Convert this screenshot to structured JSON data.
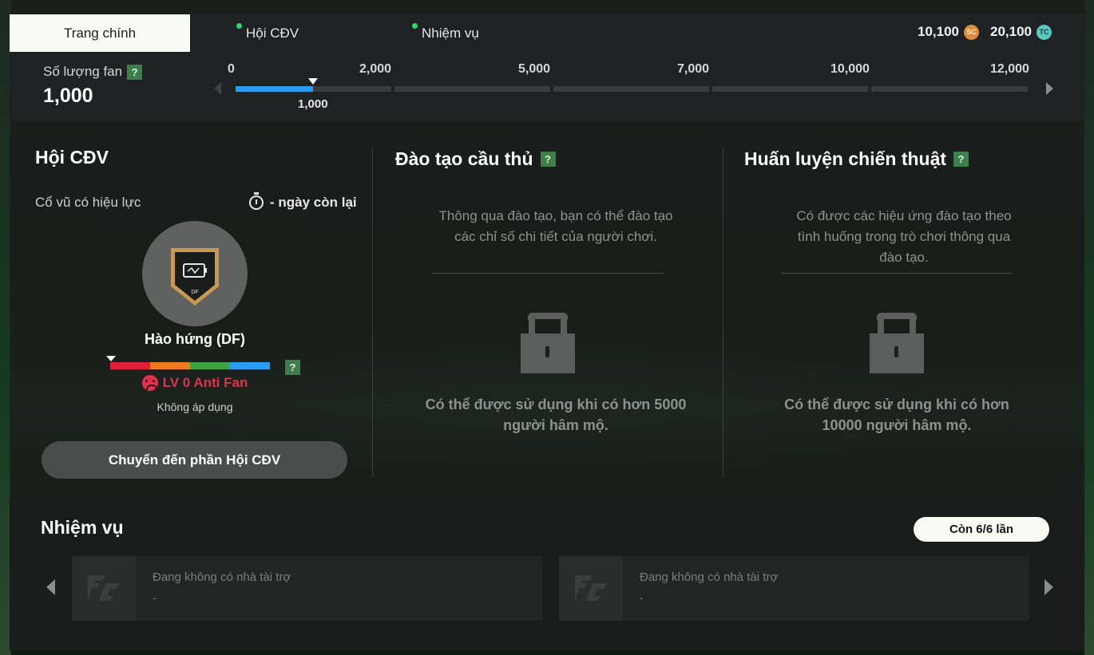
{
  "tabs": {
    "home": "Trang chính",
    "fans": "Hội CĐV",
    "missions": "Nhiệm vụ"
  },
  "currency": {
    "sc_value": "10,100",
    "sc_icon": "SC",
    "tc_value": "20,100",
    "tc_icon": "TC"
  },
  "fan_count": {
    "label": "Số lượng fan",
    "help": "?",
    "value": "1,000",
    "ticks": [
      "0",
      "2,000",
      "5,000",
      "7,000",
      "10,000",
      "12,000"
    ],
    "marker_label": "1,000",
    "progress_fraction": 0.495
  },
  "fan_club": {
    "title": "Hội CĐV",
    "effect_label": "Cổ vũ có hiệu lực",
    "days_left": "- ngày còn lại",
    "badge_code": "DF",
    "mood_name": "Hào hứng (DF)",
    "mood_help": "?",
    "level_text": "LV 0 Anti Fan",
    "status": "Không áp dụng",
    "goto_button": "Chuyển đến phần Hội CĐV",
    "mood_colors": [
      "#e01e3c",
      "#f07a1e",
      "#3fa544",
      "#2b9df0"
    ]
  },
  "player_training": {
    "title": "Đào tạo cầu thủ",
    "help": "?",
    "desc_line1": "Thông qua đào tạo, bạn có thể đào tạo",
    "desc_line2": "các chỉ số chi tiết của người chơi.",
    "lock_line1": "Có thể được sử dụng khi có hơn 5000",
    "lock_line2": "người hâm mộ."
  },
  "tactical_training": {
    "title": "Huấn luyện chiến thuật",
    "help": "?",
    "desc_line1": "Có được các hiệu ứng đào tạo theo",
    "desc_line2": "tình huống trong trò chơi thông qua",
    "desc_line3": "đào tạo.",
    "lock_line1": "Có thể được sử dụng khi có hơn",
    "lock_line2": "10000 người hâm mộ."
  },
  "missions": {
    "title": "Nhiệm vụ",
    "remaining": "Còn 6/6 lần",
    "cards": [
      {
        "title": "Đang không có nhà tài trợ",
        "sub": "-"
      },
      {
        "title": "Đang không có nhà tài trợ",
        "sub": "-"
      }
    ]
  },
  "colors": {
    "accent_blue": "#2b9df0",
    "help_green": "#3e7e4a",
    "anti_fan_red": "#e4304f"
  }
}
